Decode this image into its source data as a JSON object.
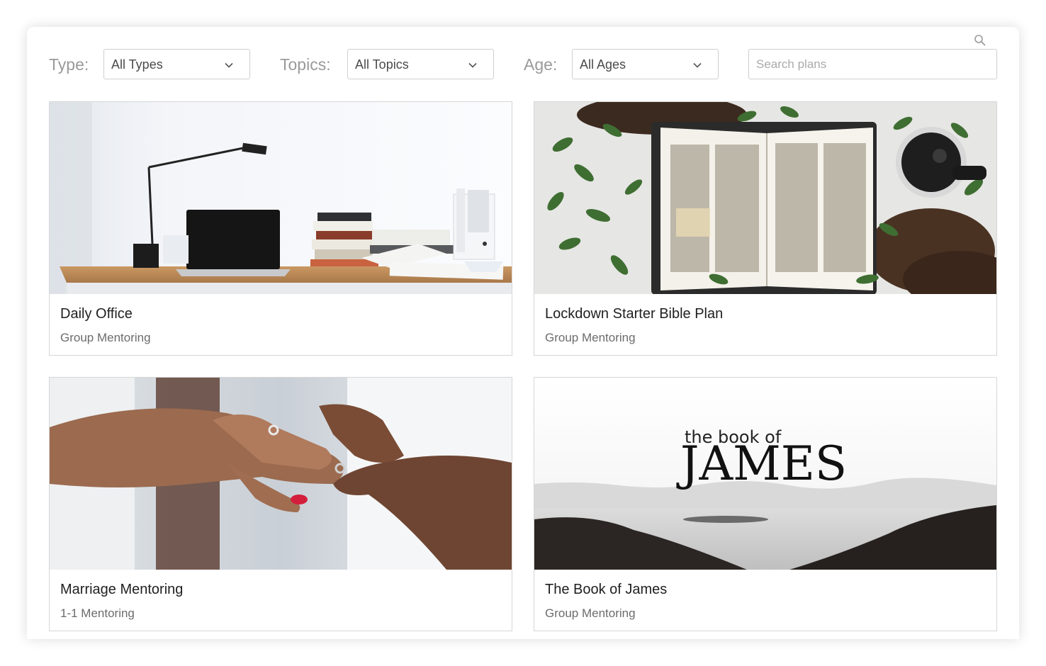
{
  "filters": {
    "type": {
      "label": "Type:",
      "value": "All Types"
    },
    "topics": {
      "label": "Topics:",
      "value": "All Topics"
    },
    "age": {
      "label": "Age:",
      "value": "All Ages"
    },
    "search": {
      "placeholder": "Search plans",
      "icon": "search-icon"
    }
  },
  "plans": [
    {
      "title": "Daily Office",
      "type": "Group Mentoring",
      "image": "desk-with-laptop-and-books"
    },
    {
      "title": "Lockdown Starter Bible Plan",
      "type": "Group Mentoring",
      "image": "open-bible-with-leaves"
    },
    {
      "title": "Marriage Mentoring",
      "type": "1-1 Mentoring",
      "image": "hands-placing-ring"
    },
    {
      "title": "The Book of James",
      "type": "Group Mentoring",
      "image": "james-lake-banner",
      "image_text": {
        "line1": "the book of",
        "line2": "JAMES"
      }
    }
  ],
  "colors": {
    "border": "#d6d6d6",
    "label": "#9a9a9a",
    "title": "#1f1f1f",
    "subtitle": "#6c6c6c"
  }
}
